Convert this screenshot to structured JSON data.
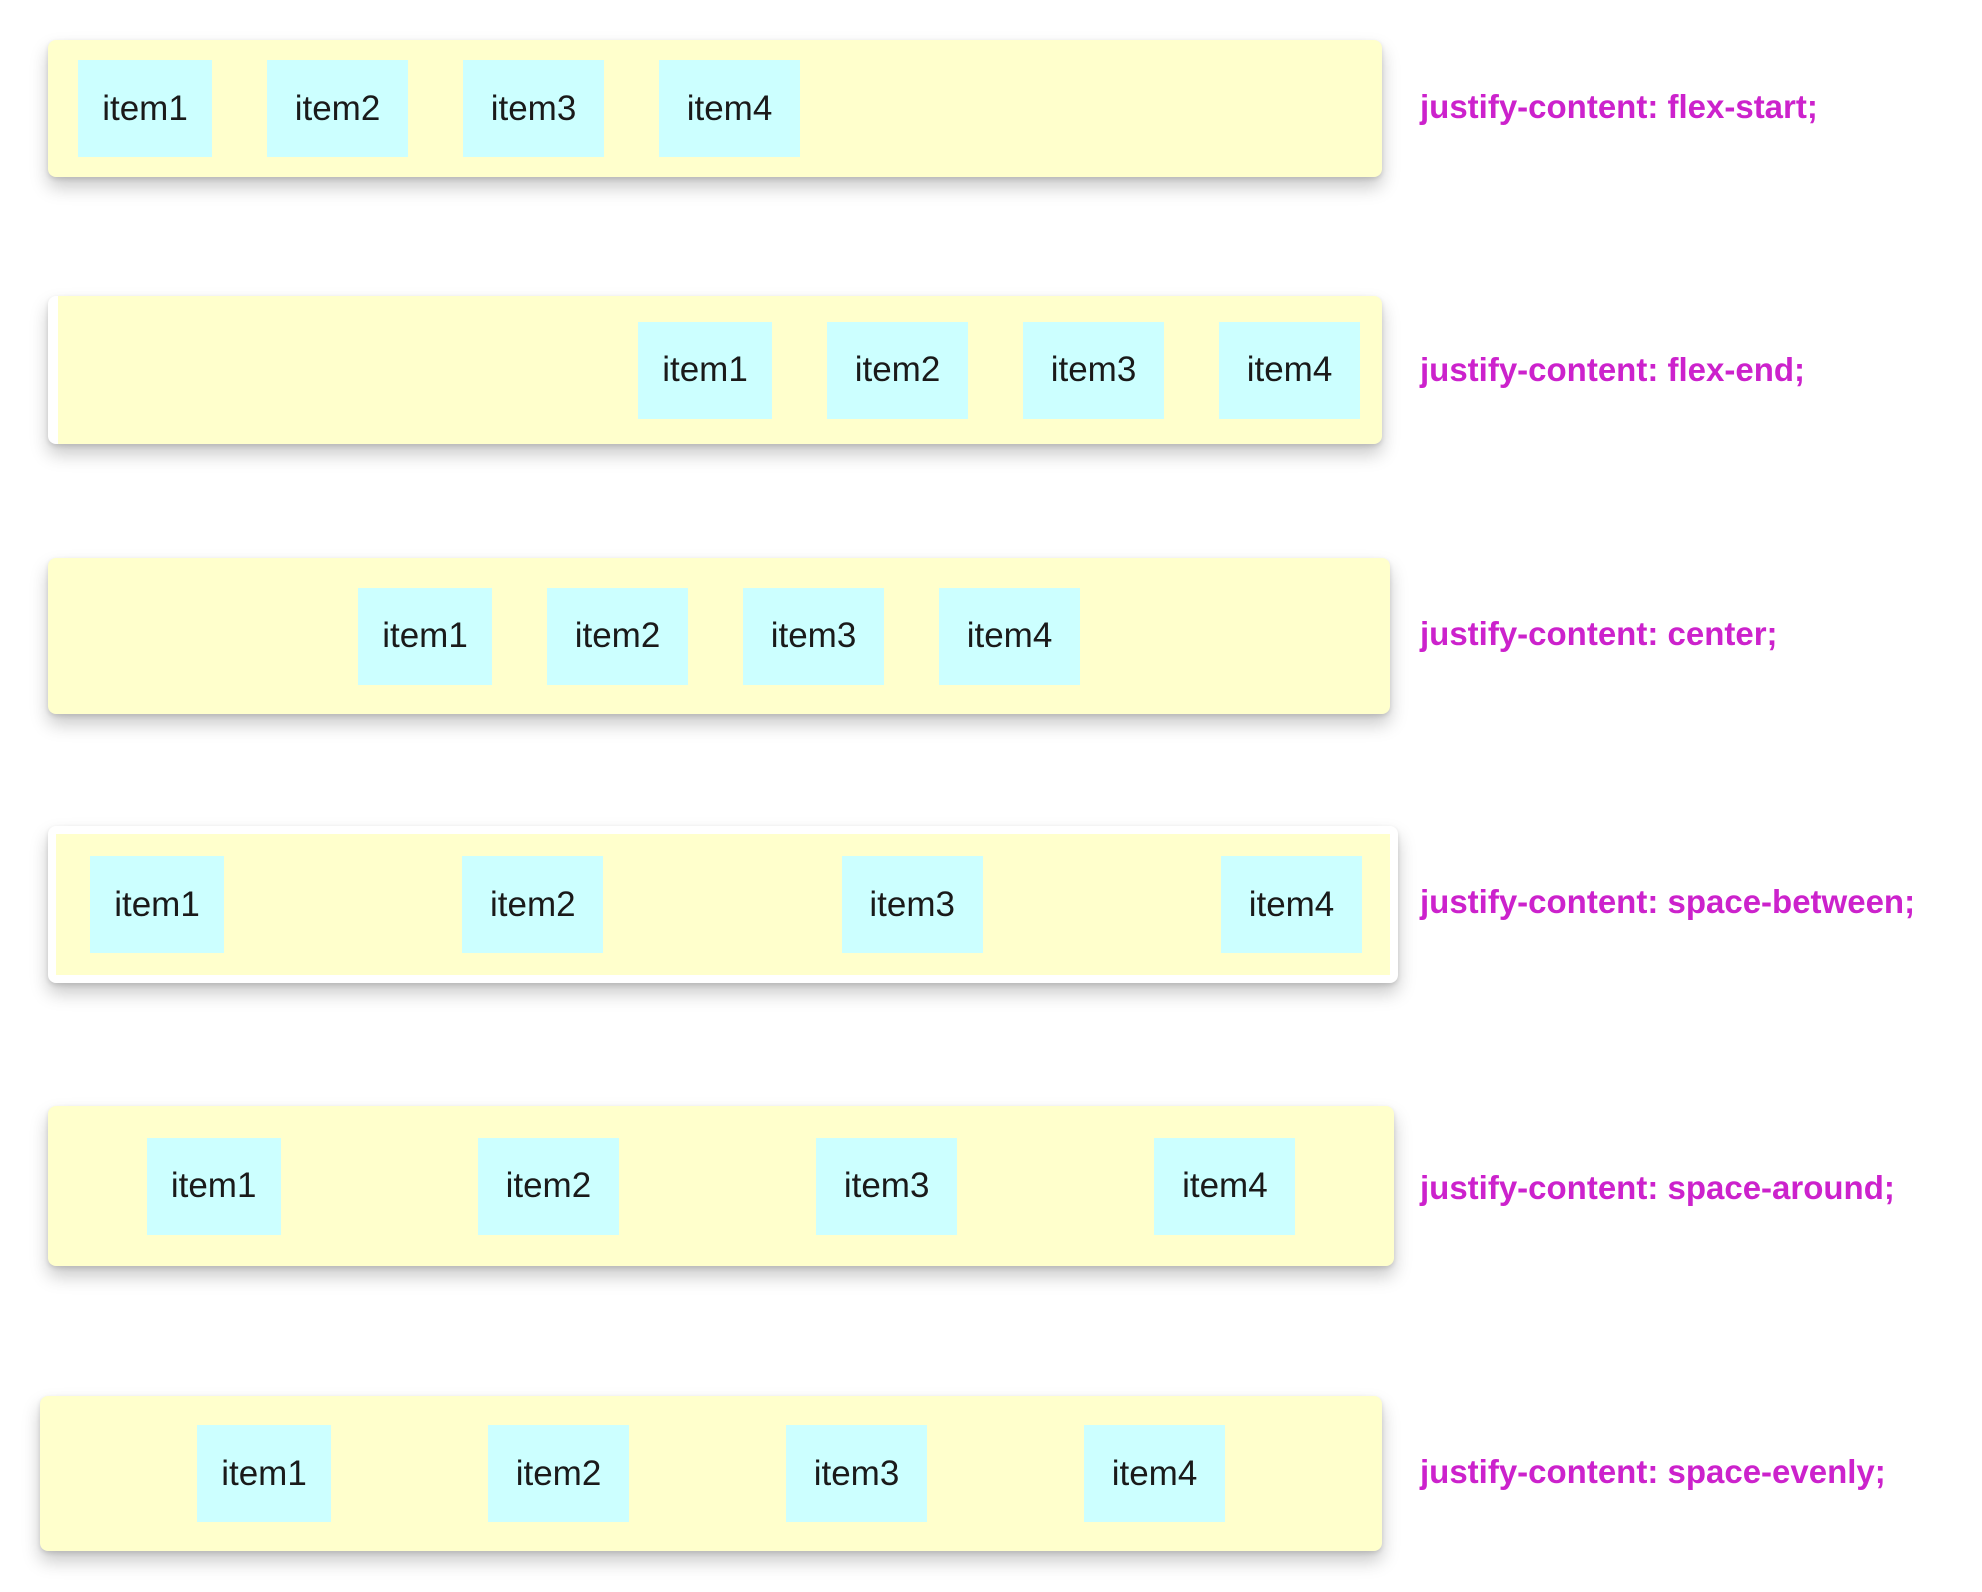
{
  "demos": [
    {
      "label": "justify-content: flex-start;",
      "items": [
        "item1",
        "item2",
        "item3",
        "item4"
      ]
    },
    {
      "label": "justify-content: flex-end;",
      "items": [
        "item1",
        "item2",
        "item3",
        "item4"
      ]
    },
    {
      "label": "justify-content: center;",
      "items": [
        "item1",
        "item2",
        "item3",
        "item4"
      ]
    },
    {
      "label": "justify-content: space-between;",
      "items": [
        "item1",
        "item2",
        "item3",
        "item4"
      ]
    },
    {
      "label": "justify-content: space-around;",
      "items": [
        "item1",
        "item2",
        "item3",
        "item4"
      ]
    },
    {
      "label": "justify-content: space-evenly;",
      "items": [
        "item1",
        "item2",
        "item3",
        "item4"
      ]
    }
  ],
  "colors": {
    "container_bg": "#ffffcc",
    "item_bg": "#ccffff",
    "label_text": "#cc22cc",
    "item_text": "#1a1a1a"
  }
}
